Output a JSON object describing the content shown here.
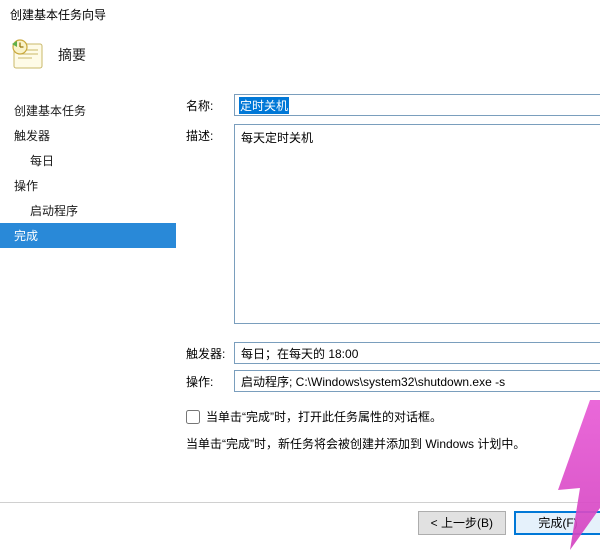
{
  "titlebar": "创建基本任务向导",
  "header": {
    "title": "摘要"
  },
  "sidebar": {
    "items": [
      {
        "label": "创建基本任务"
      },
      {
        "label": "触发器"
      },
      {
        "label": "每日"
      },
      {
        "label": "操作"
      },
      {
        "label": "启动程序"
      },
      {
        "label": "完成"
      }
    ]
  },
  "form": {
    "name_label": "名称:",
    "name_value": "定时关机",
    "desc_label": "描述:",
    "desc_value": "每天定时关机",
    "trigger_label": "触发器:",
    "trigger_value": "每日；在每天的 18:00",
    "action_label": "操作:",
    "action_value": "启动程序; C:\\Windows\\system32\\shutdown.exe -s",
    "checkbox_label": "当单击“完成”时，打开此任务属性的对话框。",
    "note": "当单击“完成”时，新任务将会被创建并添加到 Windows 计划中。"
  },
  "footer": {
    "back": "< 上一步(B)",
    "finish": "完成(F)"
  }
}
